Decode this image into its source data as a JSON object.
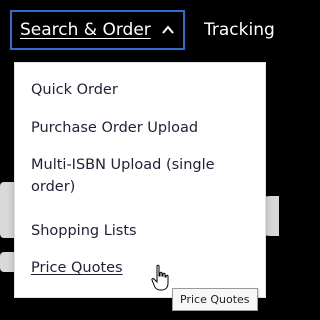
{
  "nav": {
    "active_label": "Search & Order",
    "active_icon": "chevron-up-icon",
    "next_label": "Tracking"
  },
  "menu": {
    "items": [
      {
        "label": "Quick Order"
      },
      {
        "label": "Purchase Order Upload"
      },
      {
        "label": "Multi-ISBN Upload (single order)"
      },
      {
        "label": "Shopping Lists"
      },
      {
        "label": "Price Quotes",
        "hovered": true
      }
    ]
  },
  "tooltip": {
    "text": "Price Quotes"
  },
  "colors": {
    "focus_border": "#2f6ecf",
    "menu_text": "#1f1f3a",
    "background": "#000000"
  }
}
